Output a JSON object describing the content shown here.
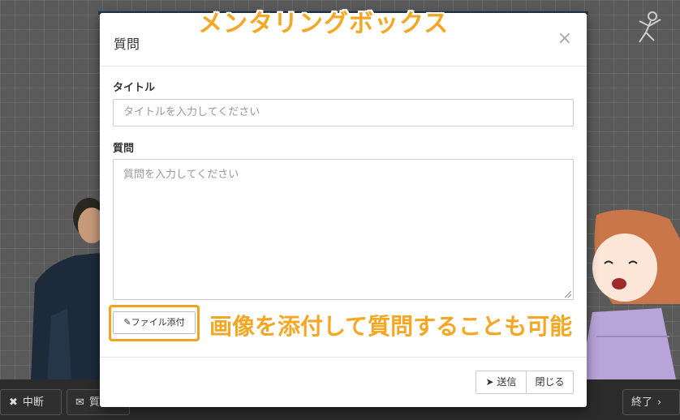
{
  "overlay": {
    "heading": "メンタリングボックス",
    "caption": "画像を添付して質問することも可能"
  },
  "modal": {
    "title": "質問",
    "close_symbol": "×",
    "title_label": "タイトル",
    "title_placeholder": "タイトルを入力してください",
    "question_label": "質問",
    "question_placeholder": "質問を入力してください",
    "attach_label": "ファイル添付",
    "send_label": "送信",
    "close_label": "閉じる"
  },
  "bottom_bar": {
    "stop_label": "中断",
    "mail_label": "質",
    "end_label": "終了"
  },
  "icons": {
    "attach": "paperclip-icon",
    "send": "paper-plane-icon",
    "stop": "x-icon",
    "mail": "envelope-icon",
    "next": "chevron-right-icon"
  },
  "colors": {
    "accent_orange": "#f5a623",
    "modal_top_border": "#1e3550"
  }
}
